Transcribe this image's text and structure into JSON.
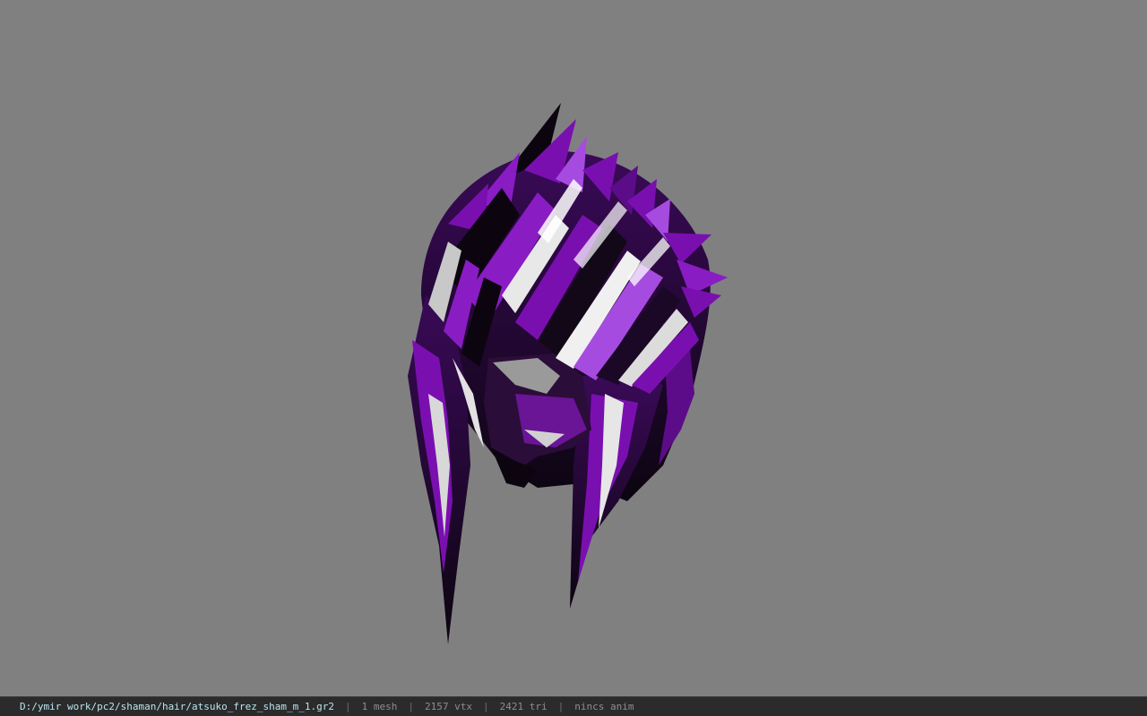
{
  "viewer": {
    "background_color": "#808080",
    "model": {
      "description_icon": "hair-mesh-model",
      "primary_color": "#7a0fb0",
      "highlight_color": "#a64be0",
      "shadow_color": "#0c0510",
      "light_color": "#e8e8e8"
    }
  },
  "statusbar": {
    "path": "D:/ymir work/pc2/shaman/hair/atsuko_frez_sham_m_1.gr2",
    "separator": "|",
    "mesh": "1 mesh",
    "vtx": "2157 vtx",
    "tri": "2421 tri",
    "anim": "nincs anim"
  }
}
